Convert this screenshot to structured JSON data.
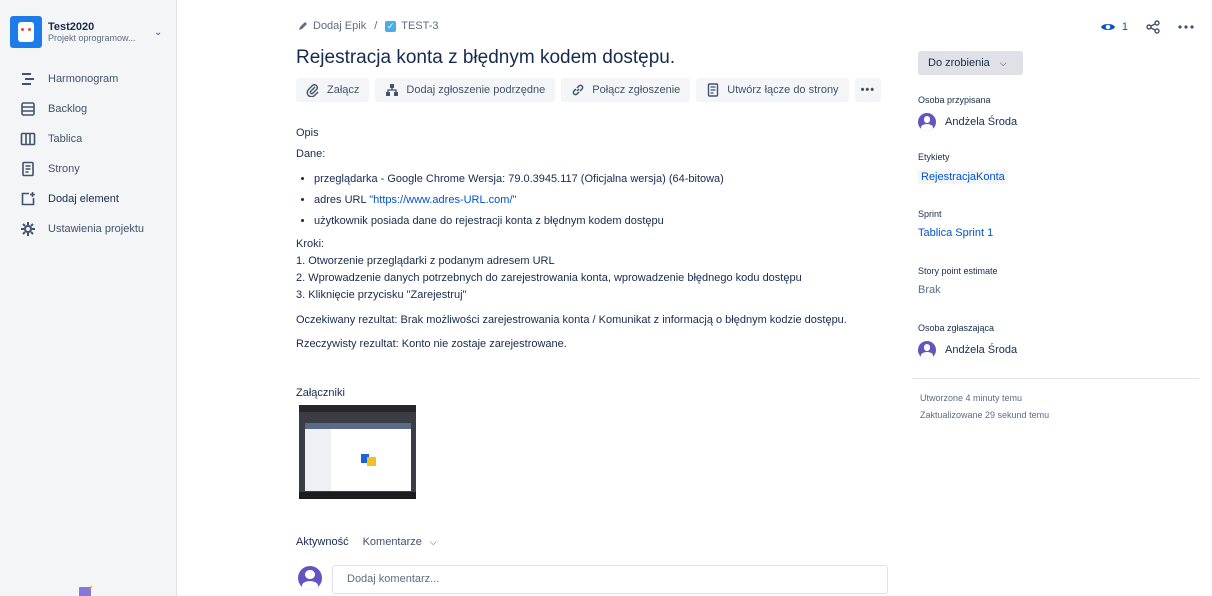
{
  "project": {
    "name": "Test2020",
    "type": "Projekt oprogramow..."
  },
  "nav": [
    {
      "label": "Harmonogram",
      "icon": "roadmap-icon"
    },
    {
      "label": "Backlog",
      "icon": "backlog-icon"
    },
    {
      "label": "Tablica",
      "icon": "board-icon"
    },
    {
      "label": "Strony",
      "icon": "pages-icon"
    },
    {
      "label": "Dodaj element",
      "icon": "add-item-icon"
    },
    {
      "label": "Ustawienia projektu",
      "icon": "settings-gear-icon"
    }
  ],
  "breadcrumb": {
    "epic": "Dodaj Epik",
    "separator": "/",
    "issue_key": "TEST-3"
  },
  "issue": {
    "title": "Rejestracja konta z błędnym kodem dostępu."
  },
  "toolbar": {
    "attach": "Załącz",
    "subtask": "Dodaj zgłoszenie podrzędne",
    "link": "Połącz zgłoszenie",
    "page_link": "Utwórz łącze do strony",
    "more": "•••"
  },
  "description": {
    "heading": "Opis",
    "data_label": "Dane:",
    "bullets": {
      "b1": "przeglądarka - Google Chrome Wersja: 79.0.3945.117 (Oficjalna wersja) (64-bitowa)",
      "b2_prefix": "adres URL ",
      "b2_link": "\"https://www.adres-URL.com/\"",
      "b3": "użytkownik posiada dane do rejestracji konta z błędnym kodem dostępu"
    },
    "steps_label": "Kroki:",
    "step1": "1. Otworzenie przeglądarki z podanym adresem URL",
    "step2": "2. Wprowadzenie danych potrzebnych do zarejestrowania konta, wprowadzenie błędnego kodu dostępu",
    "step3": "3. Kliknięcie przycisku \"Zarejestruj\"",
    "expected": "Oczekiwany rezultat: Brak możliwości zarejestrowania konta / Komunikat z informacją o błędnym kodzie dostępu.",
    "actual": "Rzeczywisty rezultat: Konto nie zostaje zarejestrowane."
  },
  "attachments": {
    "heading": "Załączniki"
  },
  "activity": {
    "heading": "Aktywność",
    "filter": "Komentarze",
    "comment_placeholder": "Dodaj komentarz..."
  },
  "topright": {
    "watch_count": "1"
  },
  "status": {
    "label": "Do zrobienia"
  },
  "fields": {
    "assignee_label": "Osoba przypisana",
    "assignee": "Andżela Środa",
    "labels_label": "Etykiety",
    "label_value": "RejestracjaKonta",
    "sprint_label": "Sprint",
    "sprint": "Tablica Sprint 1",
    "sp_label": "Story point estimate",
    "sp_value": "Brak",
    "reporter_label": "Osoba zgłaszająca",
    "reporter": "Andżela Środa"
  },
  "meta": {
    "created": "Utworzone 4 minuty temu",
    "updated": "Zaktualizowane 29 sekund temu"
  },
  "colors": {
    "primary": "#0052cc",
    "sidebar_bg": "#f4f5f7",
    "avatar": "#6554c0",
    "status_bg": "#dfe1e6"
  }
}
